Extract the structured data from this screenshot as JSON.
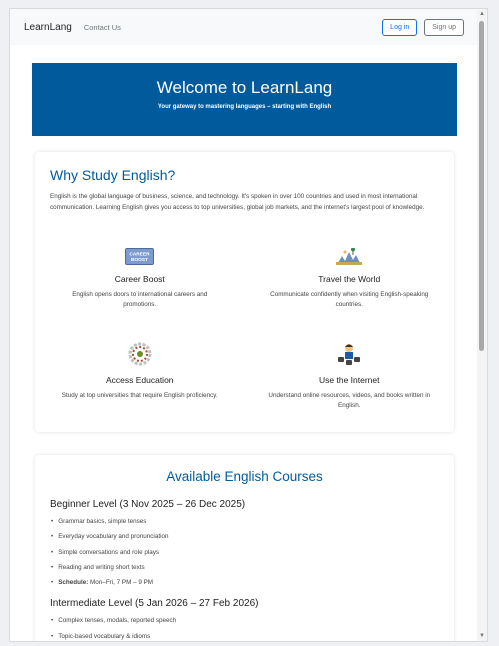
{
  "navbar": {
    "brand": "LearnLang",
    "contact_label": "Contact Us",
    "login_label": "Log in",
    "signup_label": "Sign up"
  },
  "hero": {
    "title": "Welcome to LearnLang",
    "subtitle": "Your gateway to mastering languages – starting with English"
  },
  "why": {
    "title": "Why Study English?",
    "intro": "English is the global language of business, science, and technology. It's spoken in over 100 countries and used in most international communication. Learning English gives you access to top universities, global job markets, and the internet's largest pool of knowledge.",
    "features": [
      {
        "icon": "career-boost-icon",
        "icon_text": "CAREER BOOST",
        "title": "Career Boost",
        "desc": "English opens doors to international careers and promotions."
      },
      {
        "icon": "travel-icon",
        "title": "Travel the World",
        "desc": "Communicate confidently when visiting English-speaking countries."
      },
      {
        "icon": "education-icon",
        "title": "Access Education",
        "desc": "Study at top universities that require English proficiency."
      },
      {
        "icon": "internet-icon",
        "title": "Use the Internet",
        "desc": "Understand online resources, videos, and books written in English."
      }
    ]
  },
  "courses": {
    "title": "Available English Courses",
    "levels": [
      {
        "title": "Beginner Level (3 Nov 2025 – 26 Dec 2025)",
        "items": [
          "Grammar basics, simple tenses",
          "Everyday vocabulary and pronunciation",
          "Simple conversations and role plays",
          "Reading and writing short texts"
        ],
        "schedule_label": "Schedule:",
        "schedule_value": " Mon–Fri, 7 PM – 9 PM"
      },
      {
        "title": "Intermediate Level (5 Jan 2026 – 27 Feb 2026)",
        "items": [
          "Complex tenses, modals, reported speech",
          "Topic-based vocabulary & idioms"
        ]
      }
    ]
  },
  "colors": {
    "primary": "#005a9c",
    "login_border": "#0d6efd",
    "secondary": "#6c757d"
  }
}
